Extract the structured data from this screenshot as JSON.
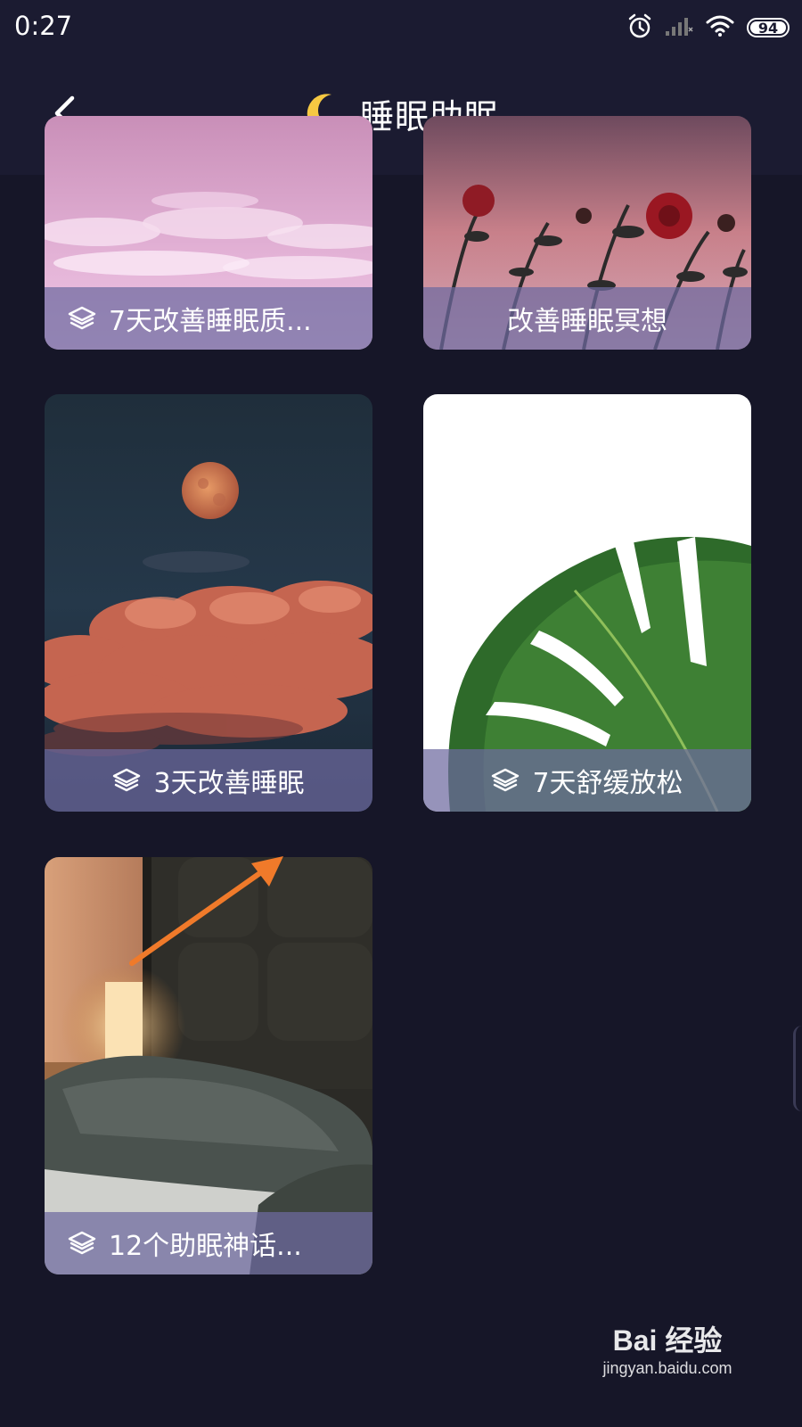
{
  "status_bar": {
    "time": "0:27",
    "battery": "94",
    "icons": [
      "alarm-icon",
      "signal-icon",
      "wifi-icon",
      "battery-icon"
    ]
  },
  "header": {
    "title": "睡眠助眠",
    "back_icon": "back-arrow-icon",
    "title_icon": "crescent-moon-icon"
  },
  "cards": [
    {
      "label": "7天改善睡眠质...",
      "icon": "layers-icon",
      "image": "pink-clouds"
    },
    {
      "label": "改善睡眠冥想",
      "icon": "",
      "image": "red-flowers-sunset"
    },
    {
      "label": "3天改善睡眠",
      "icon": "layers-icon",
      "image": "moon-clouds"
    },
    {
      "label": "7天舒缓放松",
      "icon": "layers-icon",
      "image": "monstera-leaf"
    },
    {
      "label": "12个助眠神话...",
      "icon": "layers-icon",
      "image": "bedroom-lamp"
    }
  ],
  "annotation": {
    "icon": "orange-arrow-icon"
  },
  "watermark": {
    "brand": "Bai 经验",
    "url": "jingyan.baidu.com"
  },
  "colors": {
    "background": "#161628",
    "header": "#1b1b31",
    "label_overlay": "#6e69a0",
    "moon": "#f5c842",
    "arrow": "#f07a2a"
  }
}
